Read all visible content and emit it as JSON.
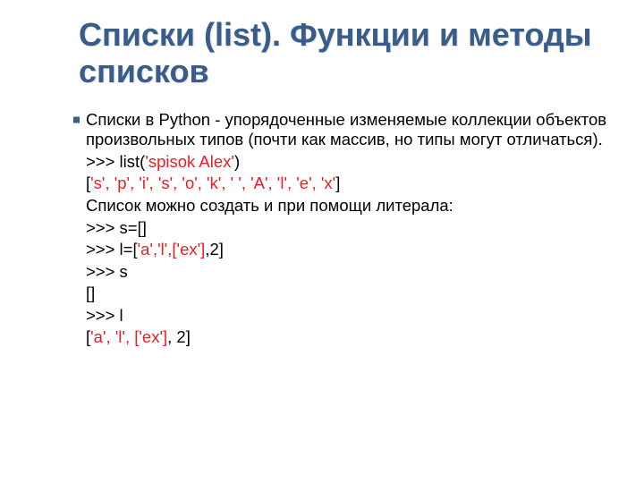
{
  "title": "Списки (list). Функции и методы списков",
  "intro": "Списки в Python - упорядоченные изменяемые коллекции объектов произвольных типов (почти как массив, но типы могут отличаться).",
  "lines": {
    "l1_prefix": ">>> list(",
    "l1_str": "'spisok Alex'",
    "l1_suffix": ")",
    "l2_open": "[",
    "l2_items": "'s', 'p', 'i', 's', 'o', 'k', ' ', 'A', 'l', 'e', 'x'",
    "l2_close": "]",
    "l3": "Список можно создать и при помощи литерала:",
    "l4": ">>> s=[]",
    "l5_prefix": ">>> l=[",
    "l5_str": "'a','l',['ex']",
    "l5_suffix": ",2]",
    "l6": ">>> s",
    "l7": "[]",
    "l8": ">>> l",
    "l9_open": "[",
    "l9_items": "'a', 'l', ['ex']",
    "l9_suffix": ", 2]"
  }
}
